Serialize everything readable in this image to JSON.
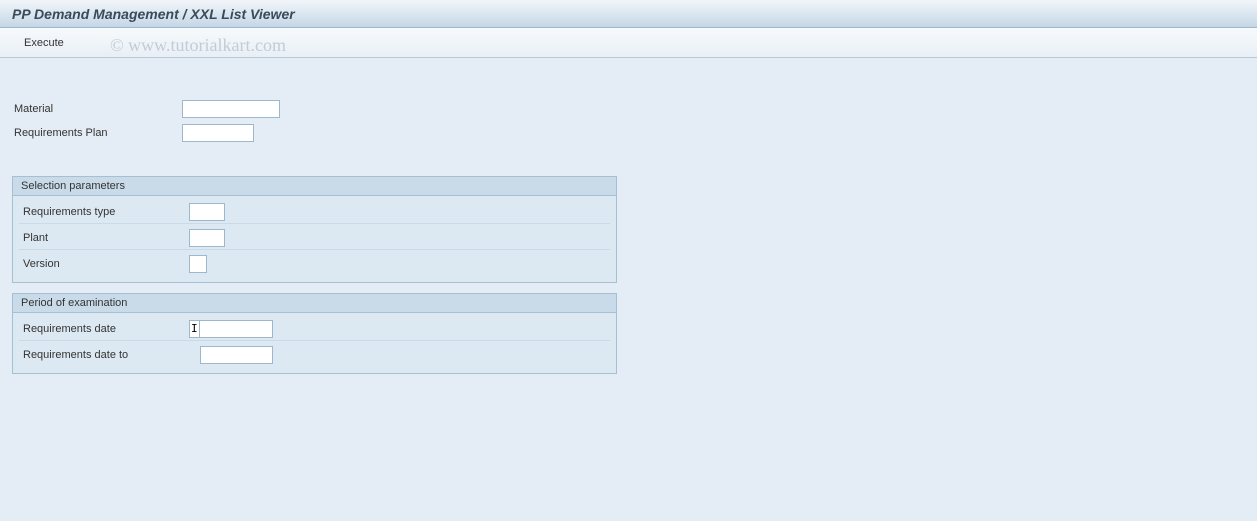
{
  "title": "PP Demand Management / XXL List Viewer",
  "toolbar": {
    "execute_label": "Execute"
  },
  "watermark": "© www.tutorialkart.com",
  "top_fields": {
    "material_label": "Material",
    "material_value": "",
    "reqplan_label": "Requirements Plan",
    "reqplan_value": ""
  },
  "group_selection": {
    "title": "Selection parameters",
    "req_type_label": "Requirements type",
    "req_type_value": "",
    "plant_label": "Plant",
    "plant_value": "",
    "version_label": "Version",
    "version_value": ""
  },
  "group_period": {
    "title": "Period of examination",
    "req_date_label": "Requirements date",
    "req_date_marker": "I",
    "req_date_value": "",
    "req_date_to_label": "Requirements date to",
    "req_date_to_value": ""
  }
}
